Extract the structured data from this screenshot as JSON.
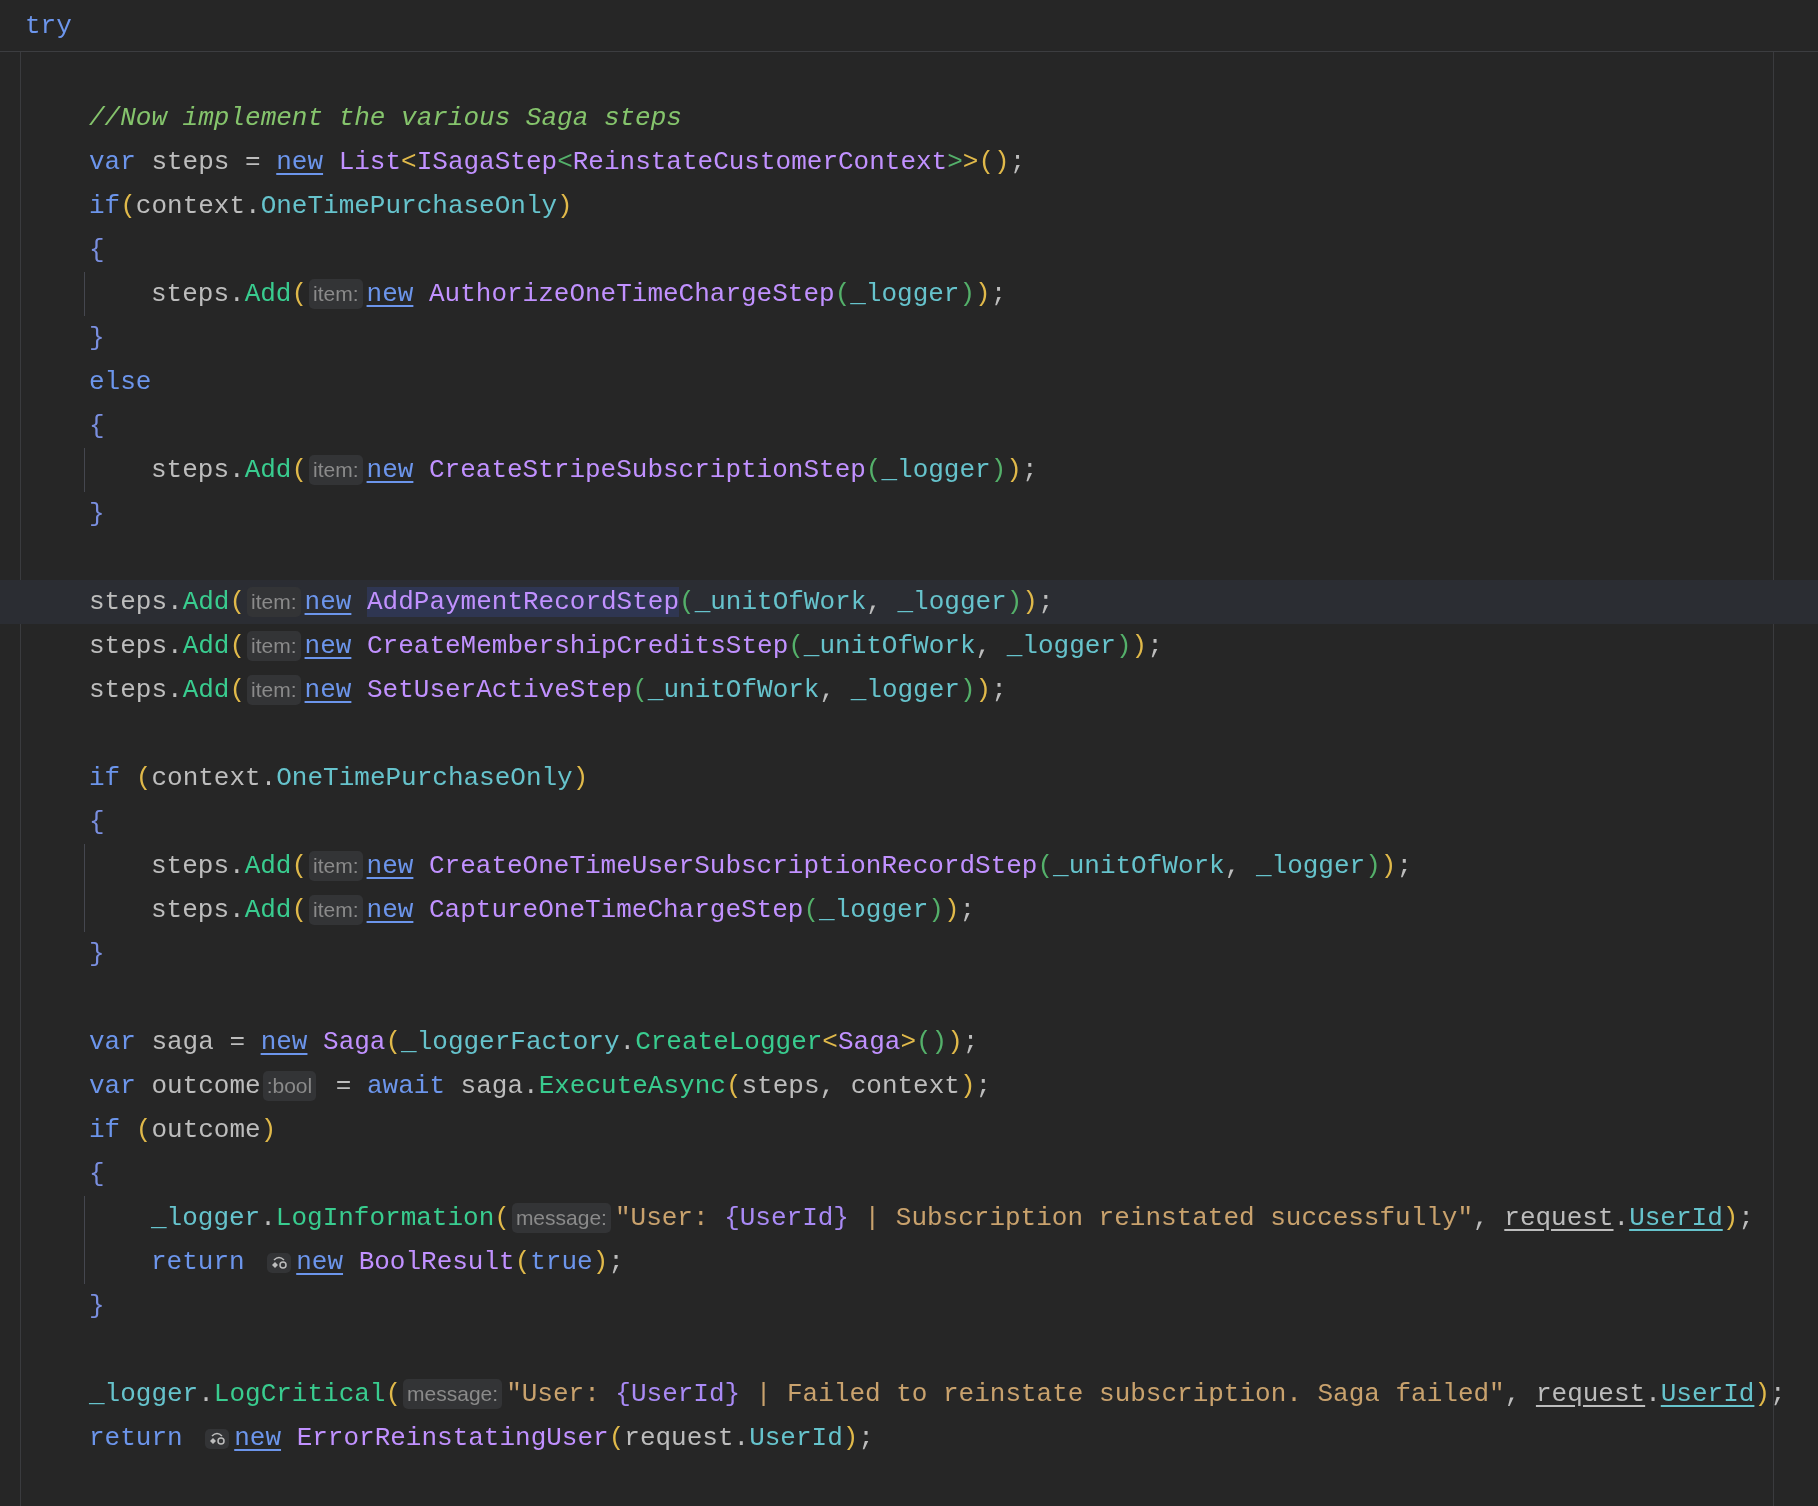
{
  "header": {
    "text": "try"
  },
  "lines": [
    {
      "current": false
    },
    {
      "current": false,
      "tokens": [
        {
          "kind": "cm",
          "text": "//Now implement the various Saga steps"
        }
      ]
    },
    {
      "current": false,
      "tokens": [
        {
          "kind": "kw",
          "text": "var"
        },
        {
          "kind": "pl",
          "text": " steps = "
        },
        {
          "kind": "new",
          "text": "new"
        },
        {
          "kind": "ty",
          "text": "List"
        },
        {
          "kind": "b1",
          "text": "<"
        },
        {
          "kind": "ty",
          "text": "ISagaStep"
        },
        {
          "kind": "b2",
          "text": "<"
        },
        {
          "kind": "ty",
          "text": "ReinstateCustomerContext"
        },
        {
          "kind": "b2",
          "text": ">"
        },
        {
          "kind": "b1",
          "text": ">()"
        },
        {
          "kind": "pl",
          "text": ";"
        }
      ]
    },
    {
      "current": false,
      "tokens": [
        {
          "kind": "kw",
          "text": "if"
        },
        {
          "kind": "b1",
          "text": "("
        },
        {
          "kind": "pl",
          "text": "context."
        },
        {
          "kind": "fi",
          "text": "OneTimePurchaseOnly"
        },
        {
          "kind": "b1",
          "text": ")"
        }
      ]
    },
    {
      "current": false,
      "tokens": [
        {
          "kind": "b3",
          "text": "{"
        }
      ],
      "children": [
        {
          "current": false,
          "tokens": [
            {
              "kind": "pl",
              "text": "steps."
            },
            {
              "kind": "me",
              "text": "Add"
            },
            {
              "kind": "b1",
              "text": "("
            },
            {
              "kind": "hint",
              "text": "item:"
            },
            {
              "kind": "new",
              "text": "new"
            },
            {
              "kind": "ty",
              "text": "AuthorizeOneTimeChargeStep"
            },
            {
              "kind": "b2",
              "text": "("
            },
            {
              "kind": "fi",
              "text": "_logger"
            },
            {
              "kind": "b2",
              "text": ")"
            },
            {
              "kind": "b1",
              "text": ")"
            },
            {
              "kind": "pl",
              "text": ";"
            }
          ]
        }
      ]
    },
    {
      "current": false,
      "tokens": [
        {
          "kind": "b3",
          "text": "}"
        }
      ]
    },
    {
      "current": false,
      "tokens": [
        {
          "kind": "kw",
          "text": "else"
        }
      ]
    },
    {
      "current": false,
      "tokens": [
        {
          "kind": "b3",
          "text": "{"
        }
      ],
      "children": [
        {
          "current": false,
          "tokens": [
            {
              "kind": "pl",
              "text": "steps."
            },
            {
              "kind": "me",
              "text": "Add"
            },
            {
              "kind": "b1",
              "text": "("
            },
            {
              "kind": "hint",
              "text": "item:"
            },
            {
              "kind": "new",
              "text": "new"
            },
            {
              "kind": "ty",
              "text": "CreateStripeSubscriptionStep"
            },
            {
              "kind": "b2",
              "text": "("
            },
            {
              "kind": "fi",
              "text": "_logger"
            },
            {
              "kind": "b2",
              "text": ")"
            },
            {
              "kind": "b1",
              "text": ")"
            },
            {
              "kind": "pl",
              "text": ";"
            }
          ]
        }
      ]
    },
    {
      "current": false,
      "tokens": [
        {
          "kind": "b3",
          "text": "}"
        }
      ]
    },
    {
      "current": false
    },
    {
      "current": true,
      "tokens": [
        {
          "kind": "pl",
          "text": "steps."
        },
        {
          "kind": "me",
          "text": "Add"
        },
        {
          "kind": "b1",
          "text": "("
        },
        {
          "kind": "hint",
          "text": "item:"
        },
        {
          "kind": "new",
          "text": "new"
        },
        {
          "kind": "match",
          "text": "AddPaymentRecordStep"
        },
        {
          "kind": "b2",
          "text": "("
        },
        {
          "kind": "fi",
          "text": "_unitOfWork"
        },
        {
          "kind": "pl",
          "text": ", "
        },
        {
          "kind": "fi",
          "text": "_logger"
        },
        {
          "kind": "b2",
          "text": ")"
        },
        {
          "kind": "b1",
          "text": ")"
        },
        {
          "kind": "pl",
          "text": ";"
        }
      ]
    },
    {
      "current": false,
      "tokens": [
        {
          "kind": "pl",
          "text": "steps."
        },
        {
          "kind": "me",
          "text": "Add"
        },
        {
          "kind": "b1",
          "text": "("
        },
        {
          "kind": "hint",
          "text": "item:"
        },
        {
          "kind": "new",
          "text": "new"
        },
        {
          "kind": "ty",
          "text": "CreateMembershipCreditsStep"
        },
        {
          "kind": "b2",
          "text": "("
        },
        {
          "kind": "fi",
          "text": "_unitOfWork"
        },
        {
          "kind": "pl",
          "text": ", "
        },
        {
          "kind": "fi",
          "text": "_logger"
        },
        {
          "kind": "b2",
          "text": ")"
        },
        {
          "kind": "b1",
          "text": ")"
        },
        {
          "kind": "pl",
          "text": ";"
        }
      ]
    },
    {
      "current": false,
      "tokens": [
        {
          "kind": "pl",
          "text": "steps."
        },
        {
          "kind": "me",
          "text": "Add"
        },
        {
          "kind": "b1",
          "text": "("
        },
        {
          "kind": "hint",
          "text": "item:"
        },
        {
          "kind": "new",
          "text": "new"
        },
        {
          "kind": "ty",
          "text": "SetUserActiveStep"
        },
        {
          "kind": "b2",
          "text": "("
        },
        {
          "kind": "fi",
          "text": "_unitOfWork"
        },
        {
          "kind": "pl",
          "text": ", "
        },
        {
          "kind": "fi",
          "text": "_logger"
        },
        {
          "kind": "b2",
          "text": ")"
        },
        {
          "kind": "b1",
          "text": ")"
        },
        {
          "kind": "pl",
          "text": ";"
        }
      ]
    },
    {
      "current": false
    },
    {
      "current": false,
      "tokens": [
        {
          "kind": "kw",
          "text": "if"
        },
        {
          "kind": "b1",
          "text": " ("
        },
        {
          "kind": "pl",
          "text": "context."
        },
        {
          "kind": "fi",
          "text": "OneTimePurchaseOnly"
        },
        {
          "kind": "b1",
          "text": ")"
        }
      ]
    },
    {
      "current": false,
      "tokens": [
        {
          "kind": "b3",
          "text": "{"
        }
      ],
      "children": [
        {
          "current": false,
          "tokens": [
            {
              "kind": "pl",
              "text": "steps."
            },
            {
              "kind": "me",
              "text": "Add"
            },
            {
              "kind": "b1",
              "text": "("
            },
            {
              "kind": "hint",
              "text": "item:"
            },
            {
              "kind": "new",
              "text": "new"
            },
            {
              "kind": "ty",
              "text": "CreateOneTimeUserSubscriptionRecordStep"
            },
            {
              "kind": "b2",
              "text": "("
            },
            {
              "kind": "fi",
              "text": "_unitOfWork"
            },
            {
              "kind": "pl",
              "text": ", "
            },
            {
              "kind": "fi",
              "text": "_logger"
            },
            {
              "kind": "b2",
              "text": ")"
            },
            {
              "kind": "b1",
              "text": ")"
            },
            {
              "kind": "pl",
              "text": ";"
            }
          ]
        },
        {
          "current": false,
          "tokens": [
            {
              "kind": "pl",
              "text": "steps."
            },
            {
              "kind": "me",
              "text": "Add"
            },
            {
              "kind": "b1",
              "text": "("
            },
            {
              "kind": "hint",
              "text": "item:"
            },
            {
              "kind": "new",
              "text": "new"
            },
            {
              "kind": "ty",
              "text": "CaptureOneTimeChargeStep"
            },
            {
              "kind": "b2",
              "text": "("
            },
            {
              "kind": "fi",
              "text": "_logger"
            },
            {
              "kind": "b2",
              "text": ")"
            },
            {
              "kind": "b1",
              "text": ")"
            },
            {
              "kind": "pl",
              "text": ";"
            }
          ]
        }
      ]
    },
    {
      "current": false,
      "tokens": [
        {
          "kind": "b3",
          "text": "}"
        }
      ]
    },
    {
      "current": false
    },
    {
      "current": false,
      "tokens": [
        {
          "kind": "kw",
          "text": "var"
        },
        {
          "kind": "pl",
          "text": " saga = "
        },
        {
          "kind": "new",
          "text": "new"
        },
        {
          "kind": "ty",
          "text": "Saga"
        },
        {
          "kind": "b1",
          "text": "("
        },
        {
          "kind": "fi",
          "text": "_loggerFactory"
        },
        {
          "kind": "pl",
          "text": "."
        },
        {
          "kind": "me",
          "text": "CreateLogger"
        },
        {
          "kind": "b1",
          "text": "<"
        },
        {
          "kind": "ty",
          "text": "Saga"
        },
        {
          "kind": "b1",
          "text": ">"
        },
        {
          "kind": "b2",
          "text": "()"
        },
        {
          "kind": "b1",
          "text": ")"
        },
        {
          "kind": "pl",
          "text": ";"
        }
      ]
    },
    {
      "current": false,
      "tokens": [
        {
          "kind": "kw",
          "text": "var"
        },
        {
          "kind": "pl",
          "text": " outcome"
        },
        {
          "kind": "hint",
          "text": ":bool"
        },
        {
          "kind": "pl",
          "text": " = "
        },
        {
          "kind": "kw",
          "text": "await"
        },
        {
          "kind": "pl",
          "text": " saga."
        },
        {
          "kind": "me",
          "text": "ExecuteAsync"
        },
        {
          "kind": "b1",
          "text": "("
        },
        {
          "kind": "pl",
          "text": "steps, context"
        },
        {
          "kind": "b1",
          "text": ")"
        },
        {
          "kind": "pl",
          "text": ";"
        }
      ]
    },
    {
      "current": false,
      "tokens": [
        {
          "kind": "kw",
          "text": "if"
        },
        {
          "kind": "b1",
          "text": " ("
        },
        {
          "kind": "pl",
          "text": "outcome"
        },
        {
          "kind": "b1",
          "text": ")"
        }
      ]
    },
    {
      "current": false,
      "tokens": [
        {
          "kind": "b3",
          "text": "{"
        }
      ],
      "children": [
        {
          "current": false,
          "tokens": [
            {
              "kind": "fi",
              "text": "_logger"
            },
            {
              "kind": "pl",
              "text": "."
            },
            {
              "kind": "me",
              "text": "LogInformation"
            },
            {
              "kind": "b1",
              "text": "("
            },
            {
              "kind": "hint",
              "text": "message:"
            },
            {
              "kind": "st",
              "text": "\"User: "
            },
            {
              "kind": "ph",
              "text": "{UserId}"
            },
            {
              "kind": "st",
              "text": " | Subscription reinstated successfully\""
            },
            {
              "kind": "pl",
              "text": ", "
            },
            {
              "kind": "ref",
              "text": "request"
            },
            {
              "kind": "pl",
              "text": "."
            },
            {
              "kind": "reff",
              "text": "UserId"
            },
            {
              "kind": "b1",
              "text": ")"
            },
            {
              "kind": "pl",
              "text": ";"
            }
          ]
        },
        {
          "current": false,
          "tokens": [
            {
              "kind": "kw",
              "text": "return "
            },
            {
              "kind": "icon"
            },
            {
              "kind": "new",
              "text": "new"
            },
            {
              "kind": "ty",
              "text": "BoolResult"
            },
            {
              "kind": "b1",
              "text": "("
            },
            {
              "kind": "kw",
              "text": "true"
            },
            {
              "kind": "b1",
              "text": ")"
            },
            {
              "kind": "pl",
              "text": ";"
            }
          ]
        }
      ]
    },
    {
      "current": false,
      "tokens": [
        {
          "kind": "b3",
          "text": "}"
        }
      ]
    },
    {
      "current": false
    },
    {
      "current": false,
      "tokens": [
        {
          "kind": "fi",
          "text": "_logger"
        },
        {
          "kind": "pl",
          "text": "."
        },
        {
          "kind": "me",
          "text": "LogCritical"
        },
        {
          "kind": "b1",
          "text": "("
        },
        {
          "kind": "hint",
          "text": "message:"
        },
        {
          "kind": "st",
          "text": "\"User: "
        },
        {
          "kind": "ph",
          "text": "{UserId}"
        },
        {
          "kind": "st",
          "text": " | Failed to reinstate subscription. Saga failed\""
        },
        {
          "kind": "pl",
          "text": ", "
        },
        {
          "kind": "ref",
          "text": "request"
        },
        {
          "kind": "pl",
          "text": "."
        },
        {
          "kind": "reff",
          "text": "UserId"
        },
        {
          "kind": "b1",
          "text": ")"
        },
        {
          "kind": "pl",
          "text": ";"
        }
      ]
    },
    {
      "current": false,
      "tokens": [
        {
          "kind": "kw",
          "text": "return "
        },
        {
          "kind": "icon"
        },
        {
          "kind": "new",
          "text": "new"
        },
        {
          "kind": "ty",
          "text": "ErrorReinstatingUser"
        },
        {
          "kind": "b1",
          "text": "("
        },
        {
          "kind": "pl",
          "text": "request."
        },
        {
          "kind": "fi",
          "text": "UserId"
        },
        {
          "kind": "b1",
          "text": ")"
        },
        {
          "kind": "pl",
          "text": ";"
        }
      ]
    }
  ]
}
